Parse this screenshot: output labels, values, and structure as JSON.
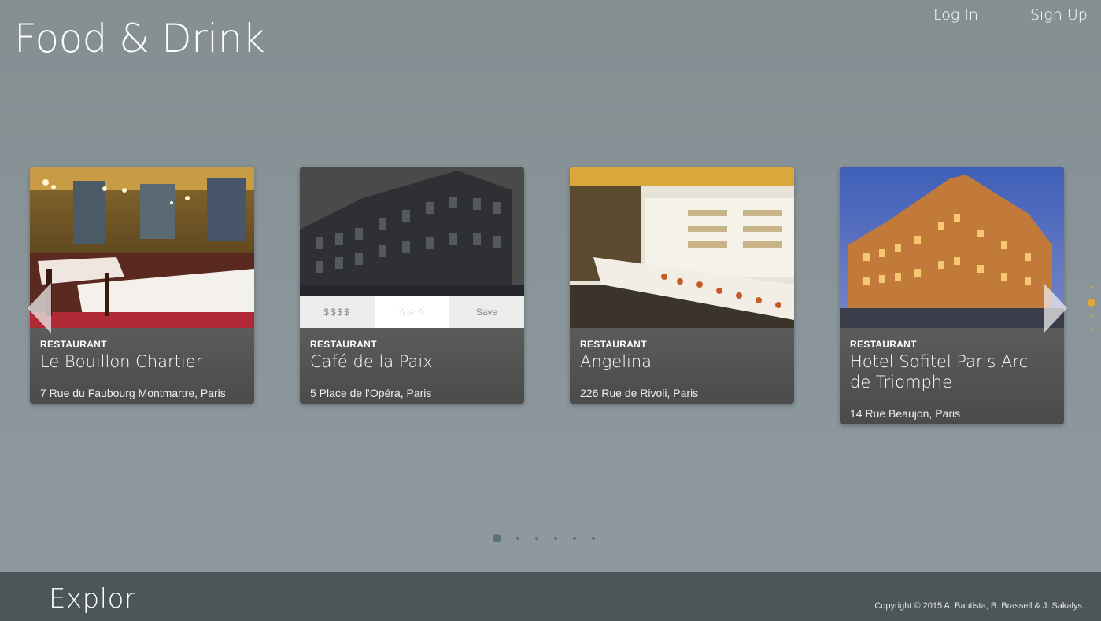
{
  "header": {
    "title": "Food & Drink",
    "login_label": "Log In",
    "signup_label": "Sign Up"
  },
  "cards": [
    {
      "type": "RESTAURANT",
      "name": "Le Bouillon Chartier",
      "address": "7 Rue du Faubourg Montmartre, Paris",
      "image": "restaurant-interior"
    },
    {
      "type": "RESTAURANT",
      "name": "Café de la Paix",
      "address": "5 Place de l'Opéra, Paris",
      "image": "building-facade",
      "hover": {
        "price": "$$$$",
        "rating": "☆☆☆",
        "save": "Save"
      }
    },
    {
      "type": "RESTAURANT",
      "name": "Angelina",
      "address": "226 Rue de Rivoli, Paris",
      "image": "patisserie-interior"
    },
    {
      "type": "RESTAURANT",
      "name": "Hotel Sofitel Paris Arc de Triomphe",
      "address": "14 Rue Beaujon, Paris",
      "image": "hotel-night"
    }
  ],
  "carousel": {
    "page_count": 6,
    "active_page": 1
  },
  "footer": {
    "logo": "Explor",
    "copyright": "Copyright © 2015 A. Bautista, B. Brassell & J. Sakalys"
  },
  "colors": {
    "accent": "#e0a73a",
    "footer_bg": "#4c5558",
    "page_bg": "#8a969b"
  }
}
